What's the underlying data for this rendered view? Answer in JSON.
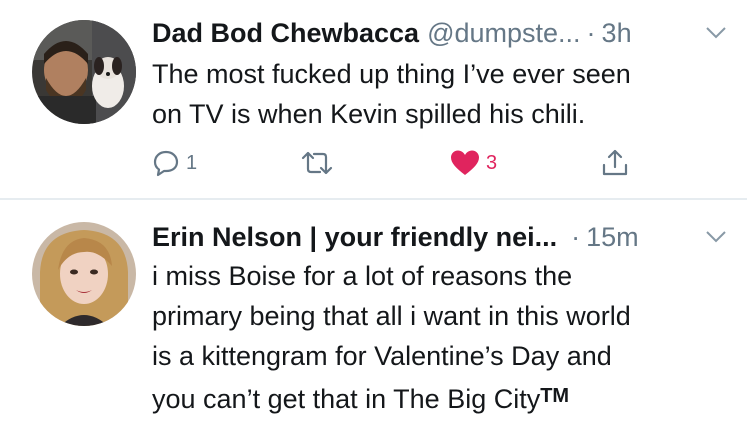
{
  "tweets": [
    {
      "author_name": "Dad Bod Chewbacca",
      "handle": "@dumpste...",
      "separator": "·",
      "time": "3h",
      "text_lines": [
        "The most fucked up thing I’ve ever seen",
        "on TV is when Kevin spilled his chili."
      ],
      "reply_count": "1",
      "retweet_count": "",
      "like_count": "3",
      "liked": true
    },
    {
      "author_name": "Erin Nelson | your friendly nei...",
      "separator": "·",
      "time": "15m",
      "text_lines": [
        "i miss Boise for a lot of reasons the",
        "primary being that all i want in this world",
        "is a kittengram for Valentine’s Day and",
        "you can’t get that in The Big City"
      ],
      "trademark": "TM"
    }
  ],
  "icons": {
    "caret": "chevron-down-icon",
    "reply": "reply-icon",
    "retweet": "retweet-icon",
    "like": "heart-icon",
    "share": "share-icon"
  },
  "colors": {
    "text": "#14171a",
    "secondary": "#657786",
    "like": "#e0245e",
    "divider": "#e6ecf0"
  }
}
